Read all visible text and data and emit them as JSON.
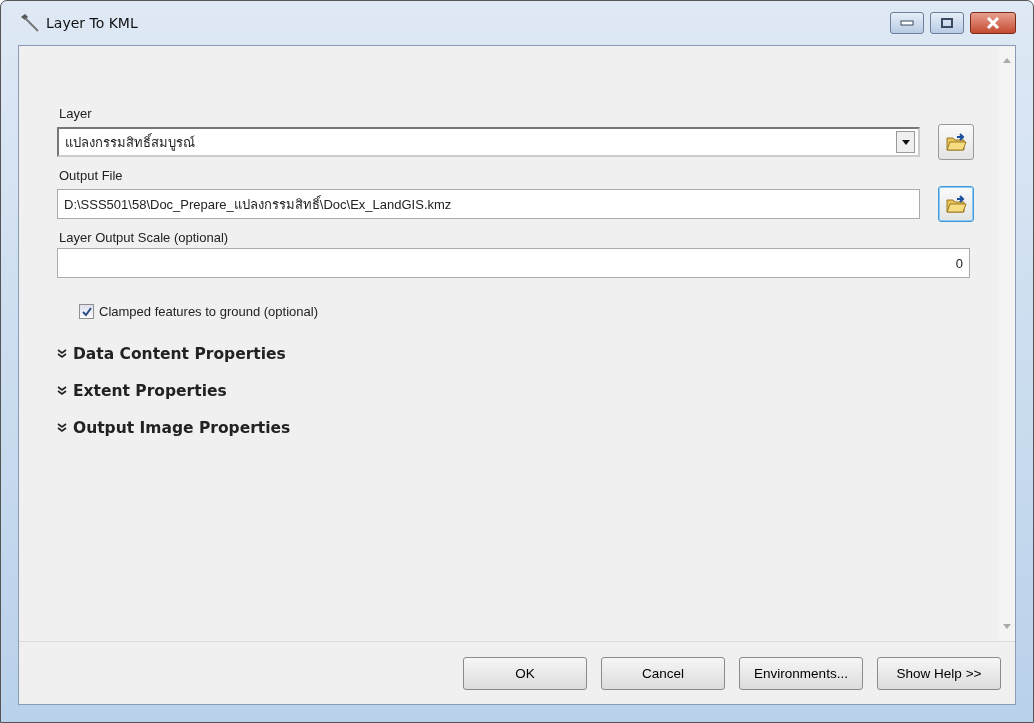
{
  "window": {
    "title": "Layer To KML"
  },
  "fields": [
    {
      "kind": "dropdown",
      "label": "Layer",
      "value": "แปลงกรรมสิทธิ์สมบูรณ์",
      "browse": true
    },
    {
      "kind": "text",
      "label": "Output File",
      "value": "D:\\SSS501\\58\\Doc_Prepare_แปลงกรรมสิทธิ์\\Doc\\Ex_LandGIS.kmz",
      "browse": true
    },
    {
      "kind": "number",
      "label": "Layer Output Scale (optional)",
      "value": "0",
      "browse": false
    }
  ],
  "checkbox": {
    "label": "Clamped features to ground (optional)",
    "checked": true
  },
  "sections": [
    {
      "label": "Data Content Properties",
      "expanded": false
    },
    {
      "label": "Extent Properties",
      "expanded": false
    },
    {
      "label": "Output Image Properties",
      "expanded": false
    }
  ],
  "buttons": [
    "OK",
    "Cancel",
    "Environments...",
    "Show Help >>"
  ]
}
